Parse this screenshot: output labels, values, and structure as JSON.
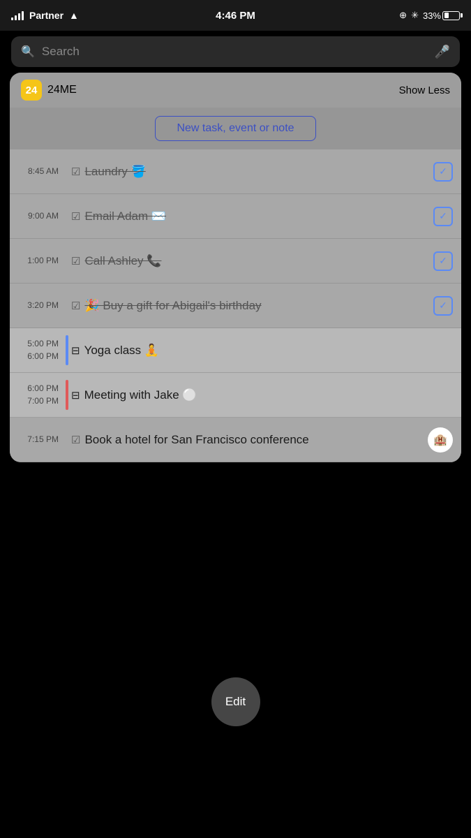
{
  "statusBar": {
    "carrier": "Partner",
    "time": "4:46 PM",
    "batteryPercent": "33%"
  },
  "searchBar": {
    "placeholder": "Search"
  },
  "widget": {
    "appIconLabel": "24",
    "appName": "24ME",
    "showLessLabel": "Show Less",
    "newTaskLabel": "New task, event or note",
    "tasks": [
      {
        "id": "laundry",
        "time1": "8:45 AM",
        "time2": "",
        "checkbox": "☑",
        "text": "Laundry 🪣",
        "strikethrough": true,
        "done": true,
        "indicator": "none",
        "isEvent": false
      },
      {
        "id": "email-adam",
        "time1": "9:00 AM",
        "time2": "",
        "checkbox": "☑",
        "text": "Email Adam ✉️",
        "strikethrough": true,
        "done": true,
        "indicator": "none",
        "isEvent": false
      },
      {
        "id": "call-ashley",
        "time1": "1:00 PM",
        "time2": "",
        "checkbox": "☑",
        "text": "Call Ashley 📞",
        "strikethrough": true,
        "done": true,
        "indicator": "none",
        "isEvent": false
      },
      {
        "id": "birthday-gift",
        "time1": "3:20 PM",
        "time2": "",
        "checkbox": "☑",
        "text": "🎉 Buy a gift for Abigail's birthday",
        "strikethrough": true,
        "done": true,
        "indicator": "none",
        "isEvent": false
      },
      {
        "id": "yoga-class",
        "time1": "5:00 PM",
        "time2": "6:00 PM",
        "checkbox": "⊟",
        "text": "Yoga class 🧘",
        "strikethrough": false,
        "done": false,
        "indicator": "blue",
        "isEvent": true
      },
      {
        "id": "meeting-jake",
        "time1": "6:00 PM",
        "time2": "7:00 PM",
        "checkbox": "⊟",
        "text": "Meeting with Jake 🔘",
        "strikethrough": false,
        "done": false,
        "indicator": "red",
        "isEvent": true
      },
      {
        "id": "book-hotel",
        "time1": "7:15 PM",
        "time2": "",
        "checkbox": "☑",
        "text": "Book a hotel for San Francisco conference 🏨",
        "strikethrough": false,
        "done": false,
        "indicator": "none",
        "isEvent": false
      }
    ]
  },
  "editButton": {
    "label": "Edit"
  }
}
